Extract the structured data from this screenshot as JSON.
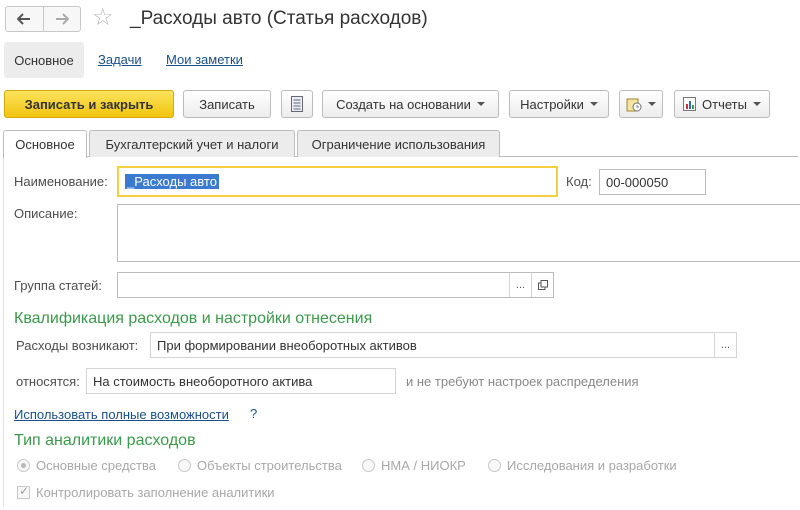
{
  "window": {
    "title": "_Расходы авто (Статья расходов)"
  },
  "sections": {
    "active": "Основное",
    "links": [
      "Задачи",
      "Мои заметки"
    ]
  },
  "toolbar": {
    "save_close": "Записать и закрыть",
    "save": "Записать",
    "create_based": "Создать на основании",
    "settings": "Настройки",
    "reports": "Отчеты"
  },
  "tabs": [
    "Основное",
    "Бухгалтерский учет и налоги",
    "Ограничение использования"
  ],
  "form": {
    "name_label": "Наименование:",
    "name_value": "_Расходы авто",
    "code_label": "Код:",
    "code_value": "00-000050",
    "description_label": "Описание:",
    "description_value": "",
    "group_label": "Группа статей:",
    "group_value": "",
    "qualification_header": "Квалификация расходов и настройки отнесения",
    "arise_label": "Расходы возникают:",
    "arise_value": "При формировании внеоборотных активов",
    "relate_label": "относятся:",
    "relate_value": "На стоимость внеоборотного актива",
    "relate_hint": "и не требуют настроек распределения",
    "full_features_link": "Использовать полные возможности",
    "help": "?",
    "analytics_header": "Тип аналитики расходов",
    "analytics_options": [
      {
        "label": "Основные средства",
        "selected": true
      },
      {
        "label": "Объекты строительства",
        "selected": false
      },
      {
        "label": "НМА / НИОКР",
        "selected": false
      },
      {
        "label": "Исследования и разработки",
        "selected": false
      }
    ],
    "control_checkbox": "Контролировать заполнение аналитики",
    "control_checked": true
  },
  "colors": {
    "primary_button": "#f1c40f",
    "link": "#1a4f8b",
    "section_header": "#3a9a4a",
    "selection": "#3a7ad0"
  }
}
